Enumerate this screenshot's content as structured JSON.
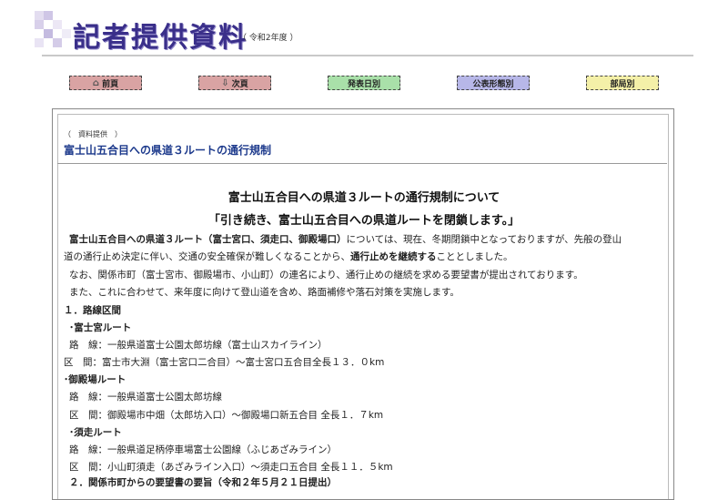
{
  "header": {
    "title": "記者提供資料",
    "year": "（ 令和2年度 ）"
  },
  "nav": {
    "prev": "前頁",
    "next": "次頁",
    "by_date": "発表日別",
    "by_format": "公表形態別",
    "by_dept": "部局別"
  },
  "colors": {
    "prev": "#d9a3a3",
    "next": "#d9a3a3",
    "by_date": "#a9e0a9",
    "by_format": "#b7b7e8",
    "by_dept": "#f4f0a8"
  },
  "content": {
    "source_label": "（　資料提供　）",
    "subject": "富士山五合目への県道３ルートの通行規制",
    "heading1": "富士山五合目への県道３ルートの通行規制について",
    "heading2": "「引き続き、富士山五合目への県道ルートを閉鎖します。」",
    "para1_bold": "富士山五合目への県道３ルート（富士宮口、須走口、御殿場口）",
    "para1_rest": "については、現在、冬期閉鎖中となっておりますが、先般の登山",
    "para1_line2_a": "道の通行止め決定に伴い、交通の安全確保が難しくなることから、",
    "para1_line2_bold": "通行止めを継続する",
    "para1_line2_b": "こととしました。",
    "para2": "なお、関係市町（富士宮市、御殿場市、小山町）の連名により、通行止めの継続を求める要望書が提出されております。",
    "para3": "また、これに合わせて、来年度に向けて登山道を含め、路面補修や落石対策を実施します。",
    "sec1": "１．路線区間",
    "r1_name": "･富士宮ルート",
    "r1_line1": "路　線：一般県道富士公園太郎坊線（富士山スカイライン）",
    "r1_line2": "区　間：富士市大淵（富士宮口二合目）～富士宮口五合目全長１３．０km",
    "r2_name": "･御殿場ルート",
    "r2_line1": "路　線：一般県道富士公園太郎坊線",
    "r2_line2": "区　間：御殿場市中畑（太郎坊入口）～御殿場口新五合目 全長１．７km",
    "r3_name": "･須走ルート",
    "r3_line1": "路　線：一般県道足柄停車場富士公園線（ふじあざみライン）",
    "r3_line2": "区　間：小山町須走（あざみライン入口）～須走口五合目 全長１１．５km",
    "sec2": "２．関係市町からの要望書の要旨（令和２年５月２１日提出）"
  }
}
